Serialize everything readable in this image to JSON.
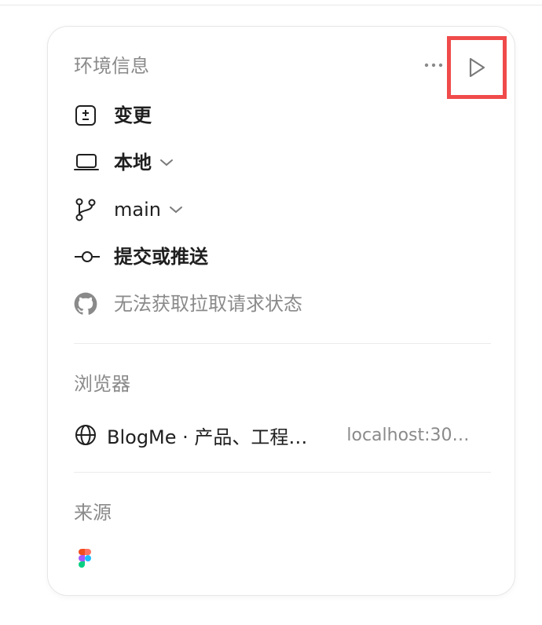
{
  "environment": {
    "title": "环境信息",
    "more_label": "···",
    "items": [
      {
        "label": "变更"
      },
      {
        "label": "本地"
      },
      {
        "label": "main"
      },
      {
        "label": "提交或推送"
      },
      {
        "label": "无法获取拉取请求状态"
      }
    ]
  },
  "browser": {
    "title": "浏览器",
    "page_title": "BlogMe · 产品、工程…",
    "url": "localhost:30…"
  },
  "source": {
    "title": "来源"
  },
  "colors": {
    "highlight_border": "#f04b4b"
  },
  "icons": [
    "diff-icon",
    "laptop-icon",
    "git-branch-icon",
    "git-commit-icon",
    "github-icon",
    "globe-icon",
    "figma-icon",
    "play-icon",
    "more-icon",
    "chevron-down-icon"
  ]
}
